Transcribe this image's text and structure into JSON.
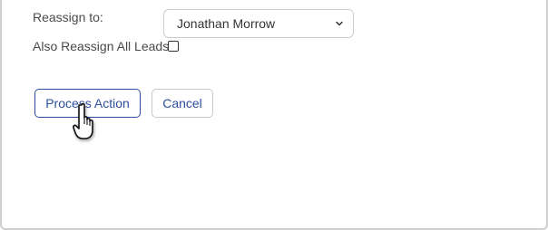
{
  "form": {
    "reassign_label": "Reassign to:",
    "reassign_value": "Jonathan Morrow",
    "also_reassign_label": "Also Reassign All Leads",
    "also_reassign_checked": false
  },
  "actions": {
    "process_label": "Process Action",
    "cancel_label": "Cancel"
  },
  "colors": {
    "accent": "#2d4f9e",
    "border": "#cfcfcf",
    "text": "#4a4a4a"
  },
  "icons": {
    "select_chevron": "chevron-down-icon",
    "cursor": "hand-pointer-cursor-icon"
  }
}
